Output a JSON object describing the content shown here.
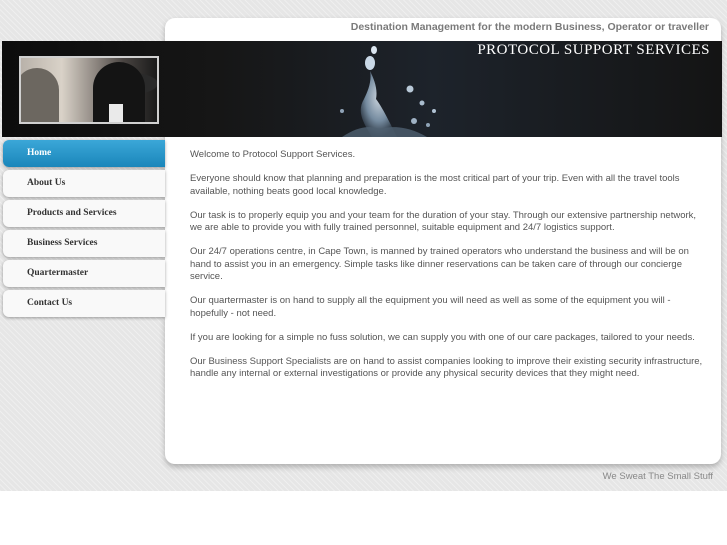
{
  "header": {
    "tagline": "Destination Management for the modern Business, Operator or traveller",
    "brand": "PROTOCOL SUPPORT SERVICES"
  },
  "nav": {
    "items": [
      {
        "label": "Home",
        "active": true
      },
      {
        "label": "About Us"
      },
      {
        "label": "Products and Services"
      },
      {
        "label": "Business Services"
      },
      {
        "label": "Quartermaster"
      },
      {
        "label": "Contact Us"
      }
    ]
  },
  "main": {
    "paragraphs": [
      "Welcome to Protocol Support Services.",
      "Everyone should know that planning and preparation is  the most critical part of your trip. Even with all the travel tools available, nothing beats good local knowledge.",
      "Our task is to properly equip you and your team for the duration of your stay. Through our extensive partnership network, we are able to provide you with fully trained personnel, suitable equipment and 24/7 logistics support.",
      "Our 24/7 operations centre, in Cape Town, is manned by trained operators who understand the business and will be on hand to assist you in an emergency. Simple tasks like dinner reservations can be taken care of through our concierge service.",
      "Our quartermaster is on hand to supply all the equipment you will need as well as some of the equipment you will - hopefully - not need.",
      "If you are looking for a simple no fuss solution, we can supply you with one of our care packages, tailored to your needs.",
      "Our Business Support Specialists are on hand to assist companies looking to improve their existing security infrastructure, handle any internal or external investigations or provide any physical security devices that they might need."
    ]
  },
  "footer": {
    "slogan": "We Sweat The Small Stuff"
  },
  "colors": {
    "accent": "#1a86ba",
    "banner_bg": "#111111",
    "text": "#555555"
  }
}
